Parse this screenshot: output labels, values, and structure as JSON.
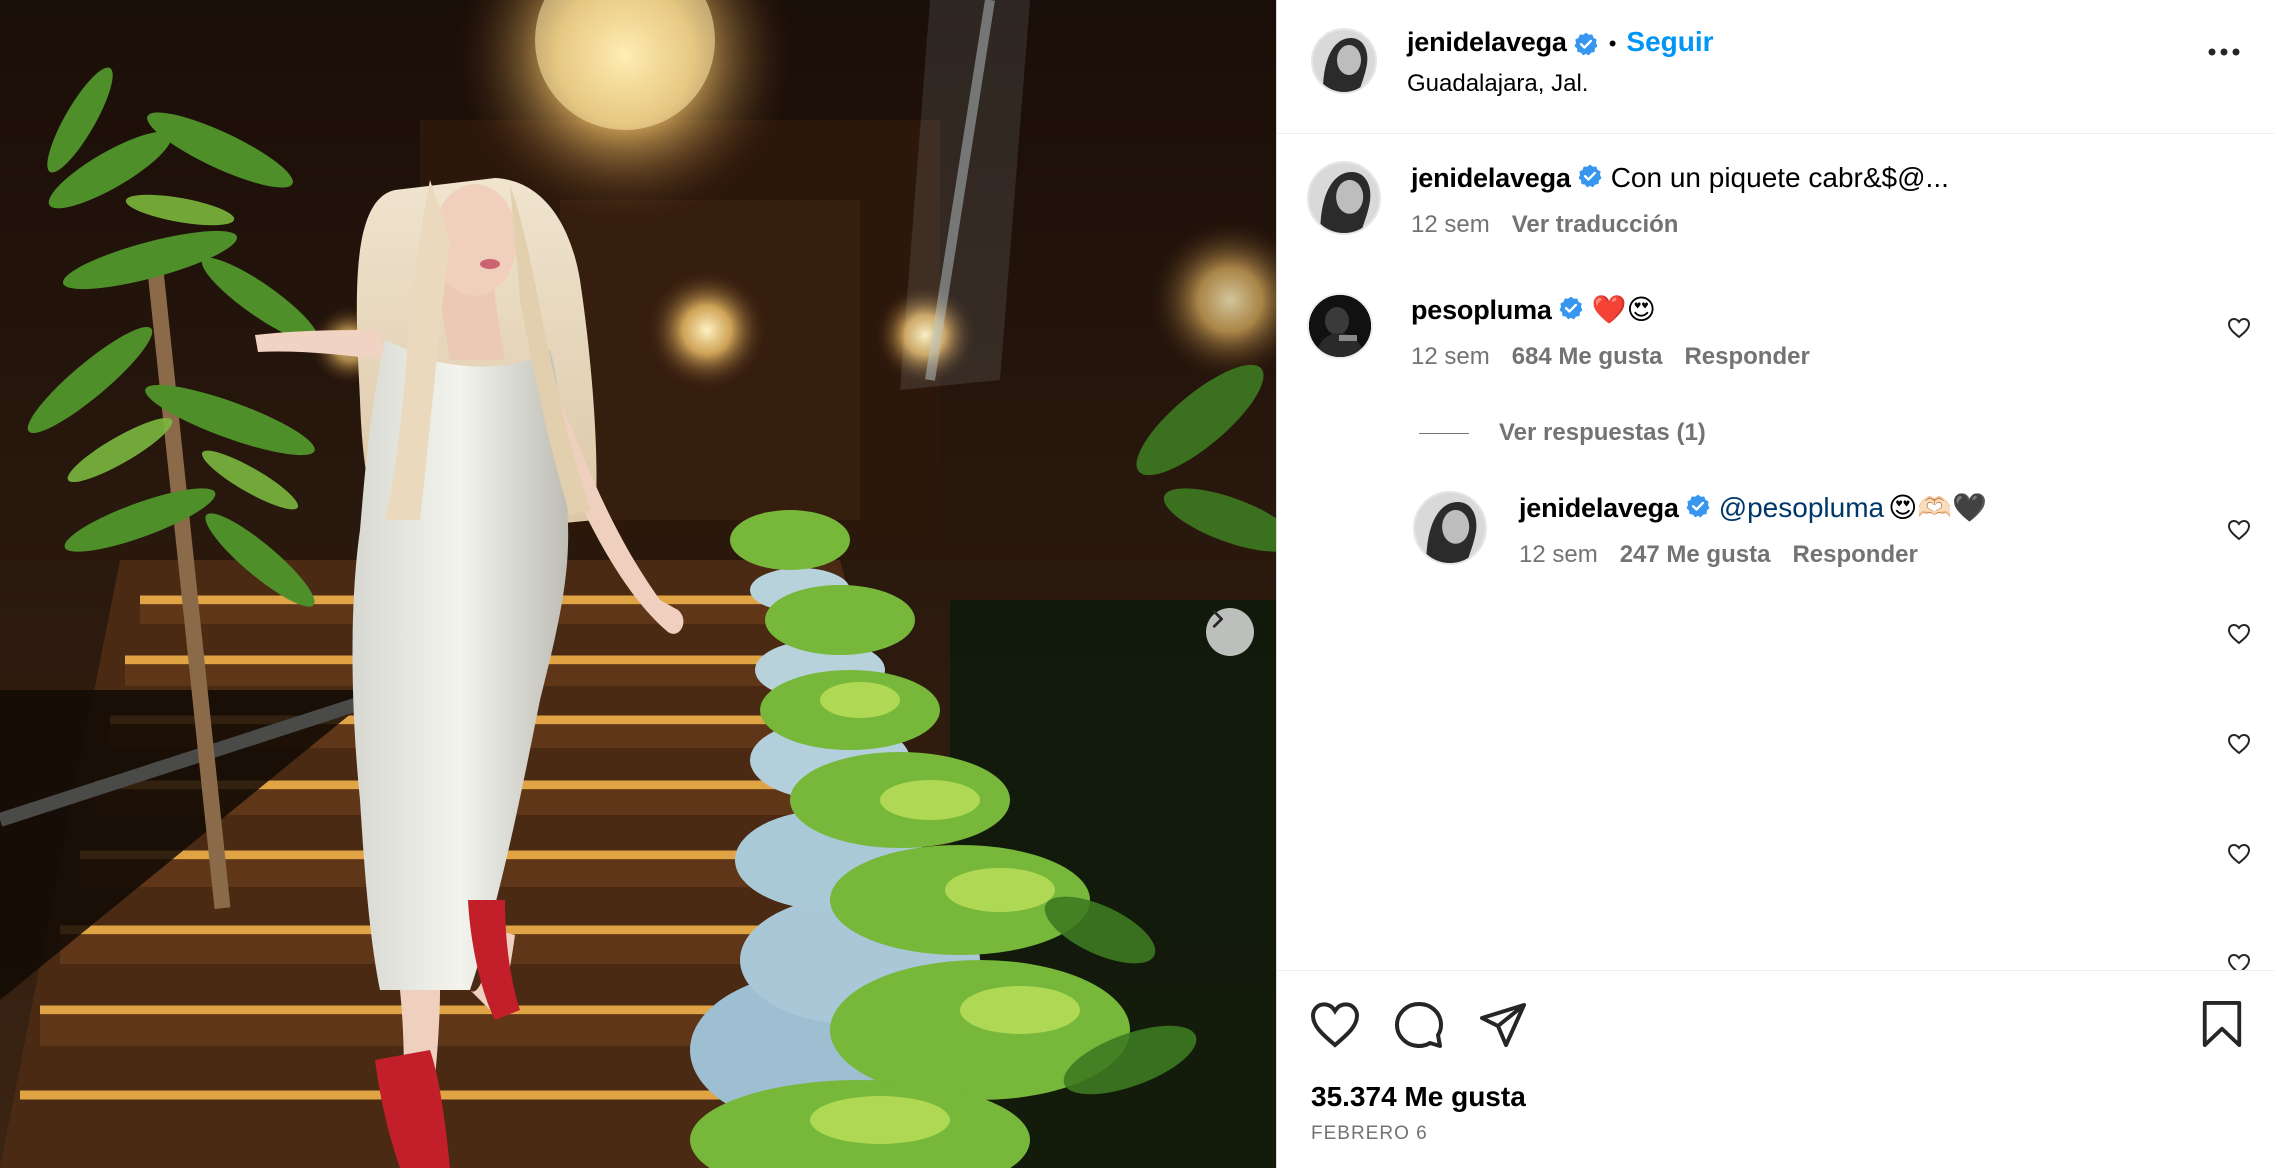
{
  "post": {
    "username": "jenidelavega",
    "follow_label": "Seguir",
    "separator": "•",
    "location": "Guadalajara, Jal."
  },
  "comments": [
    {
      "username": "jenidelavega",
      "text": "Con un piquete cabr&$@...",
      "time": "12 sem",
      "translate_label": "Ver traducción"
    },
    {
      "username": "pesopluma",
      "text": "❤️😍",
      "time": "12 sem",
      "likes": "684 Me gusta",
      "reply_label": "Responder",
      "view_replies": "Ver respuestas (1)"
    }
  ],
  "reply": {
    "username": "jenidelavega",
    "mention": "@pesopluma",
    "text": "😍🫶🏻🖤",
    "time": "12 sem",
    "likes": "247 Me gusta",
    "reply_label": "Responder"
  },
  "footer": {
    "likes": "35.374 Me gusta",
    "date": "FEBRERO 6"
  },
  "icons": {
    "verified": "verified-badge-icon",
    "more": "more-options-icon",
    "like": "heart-icon",
    "comment": "comment-icon",
    "share": "share-icon",
    "save": "bookmark-icon",
    "next": "chevron-right-icon"
  },
  "colors": {
    "accent": "#0095f6",
    "secondary_text": "#737373",
    "mention": "#00376b",
    "verified": "#3797f0"
  }
}
